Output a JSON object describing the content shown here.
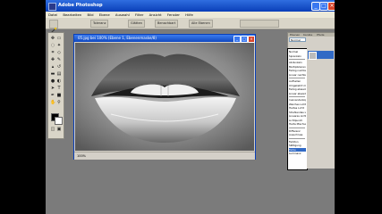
{
  "app": {
    "title": "Adobe Photoshop",
    "window_buttons": {
      "minimize": "_",
      "maximize": "□",
      "close": "×"
    }
  },
  "menu": [
    "Datei",
    "Bearbeiten",
    "Bild",
    "Ebene",
    "Auswahl",
    "Filter",
    "Ansicht",
    "Fenster",
    "Hilfe"
  ],
  "options_bar": {
    "tool_icon": "magic-wand-icon",
    "items": [
      "Toleranz",
      "Glätten",
      "Benachbart",
      "Alle Ebenen"
    ]
  },
  "document": {
    "title": "05.jpg bei 100% (Ebene 1, Ebenenmaske/8)",
    "zoom": "100%"
  },
  "layers_panel": {
    "tabs": [
      "Ebenen",
      "Kanäle",
      "Pfade"
    ],
    "blend_mode": "Normal",
    "blend_options": [
      "Normal",
      "Sprenkeln",
      "",
      "Abdunkeln",
      "Multiplizieren",
      "Farbig nachbelichten",
      "Linear nachbelichten",
      "",
      "Aufhellen",
      "Umgekehrt multiplizieren",
      "Farbig abwedeln",
      "Linear abwedeln",
      "",
      "Ineinanderkopieren",
      "Weiches Licht",
      "Hartes Licht",
      "Strahlendes Licht",
      "Lineares Licht",
      "Lichtpunkt",
      "Harte Mischung",
      "",
      "Differenz",
      "Ausschluss",
      "",
      "Farbton",
      "Sättigung",
      "Farbe",
      "Luminanz"
    ],
    "selected_option": "Farbe"
  },
  "colors": {
    "titlebar": "#0a3fb8",
    "selection": "#316ac5",
    "workspace": "#7b7b7b"
  }
}
